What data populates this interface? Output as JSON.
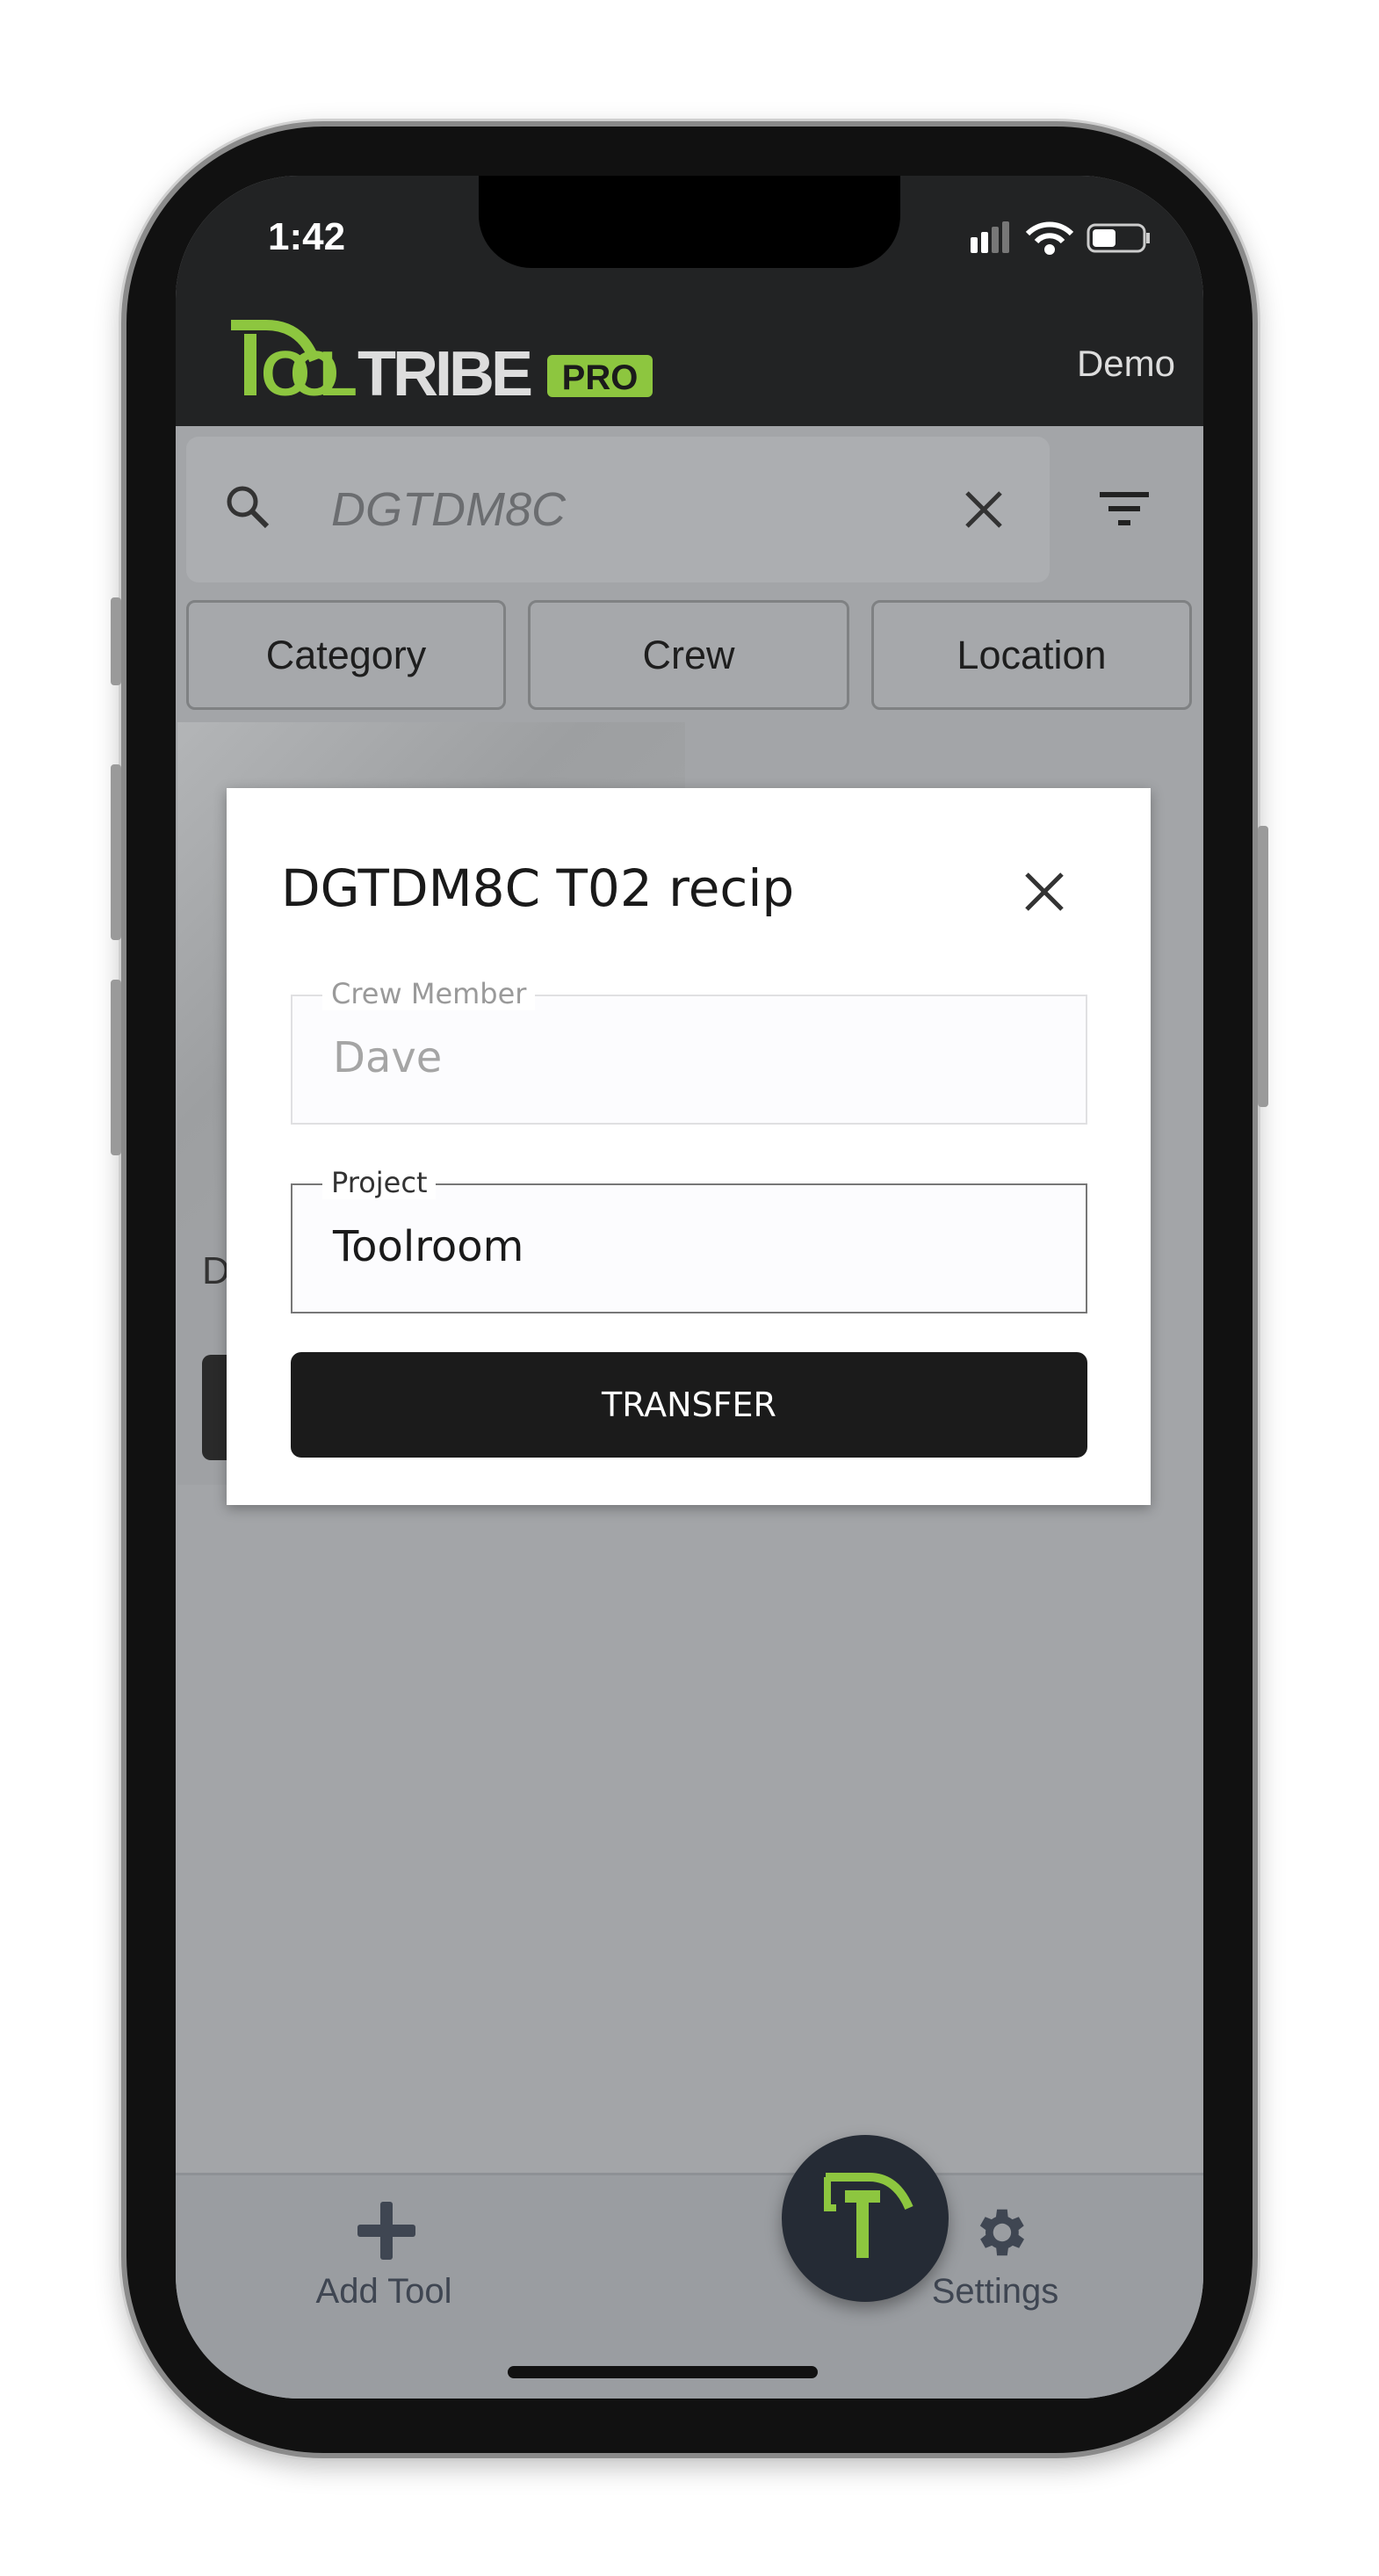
{
  "status_bar": {
    "time": "1:42"
  },
  "header": {
    "logo_text": "TOOLTRIBE PRO",
    "account": "Demo",
    "brand_color": "#8dc63f"
  },
  "search": {
    "value": "DGTDM8C"
  },
  "filters": [
    {
      "label": "Category"
    },
    {
      "label": "Crew"
    },
    {
      "label": "Location"
    }
  ],
  "card": {
    "title_initial": "D"
  },
  "modal": {
    "title": "DGTDM8C T02 recip",
    "crew_member": {
      "label": "Crew Member",
      "value": "Dave"
    },
    "project": {
      "label": "Project",
      "value": "Toolroom"
    },
    "submit_label": "TRANSFER"
  },
  "bottom_nav": {
    "add_tool": "Add Tool",
    "settings": "Settings"
  }
}
